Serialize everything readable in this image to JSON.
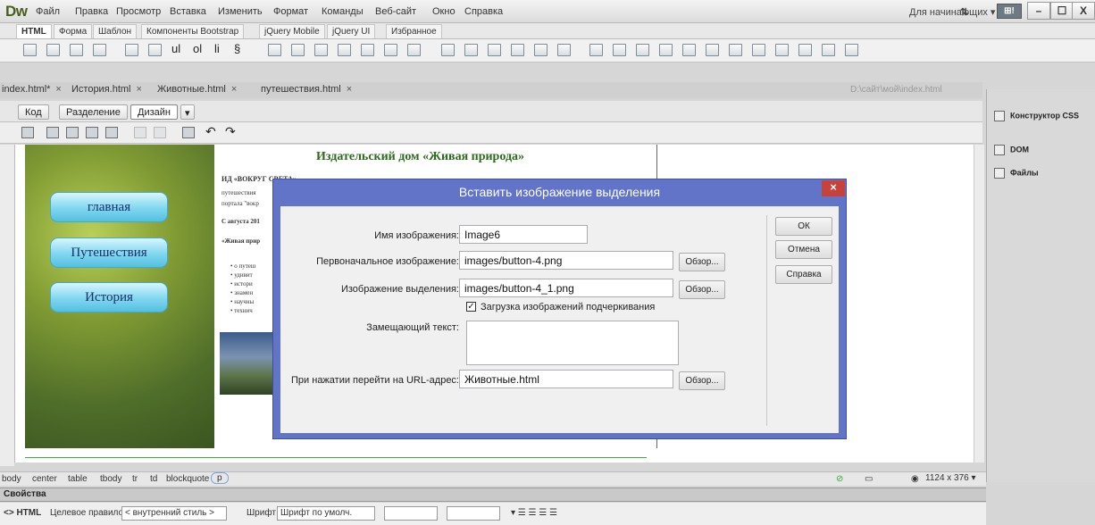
{
  "app": {
    "logo": "Dw",
    "menu": [
      "Файл",
      "Правка",
      "Просмотр",
      "Вставка",
      "Изменить",
      "Формат",
      "Команды",
      "Веб-сайт",
      "Окно",
      "Справка"
    ],
    "workspace": "Для начинающих ▾",
    "workspace_btn": "⊞!",
    "window_controls": [
      "–",
      "☐",
      "X"
    ]
  },
  "insert_tabs": [
    "HTML",
    "Форма",
    "Шаблон",
    "Компоненты Bootstrap",
    "jQuery Mobile",
    "jQuery UI",
    "Избранное"
  ],
  "document_tabs": [
    {
      "label": "index.html*"
    },
    {
      "label": "История.html"
    },
    {
      "label": "Животные.html"
    },
    {
      "label": "путешествия.html"
    }
  ],
  "document_path": "D:\\сайт\\мой\\index.html",
  "view_bar": {
    "code": "Код",
    "split": "Разделение",
    "design": "Дизайн",
    "dropdown": "▾"
  },
  "page": {
    "site_title": "Издательский дом «Живая природа»",
    "nav": [
      "главная",
      "Путешествия",
      "История"
    ],
    "text_lines": [
      "ИД «ВОКРУГ СВЕТА»",
      "путешествия",
      "портала \"вокр",
      "С августа 201",
      "«Живая прир",
      "• о путеш",
      "• удивит",
      "• истори",
      "• знамен",
      "• научны",
      "• технич"
    ]
  },
  "status_bar": {
    "tags": [
      "body",
      "center",
      "table",
      "tbody",
      "tr",
      "td",
      "blockquote",
      "p"
    ],
    "size": "1124 x 376 ▾"
  },
  "properties": {
    "title": "Свойства",
    "html_label": "<> HTML",
    "target_rule_label": "Целевое правило",
    "target_rule_value": "< внутренний стиль >",
    "font_label": "Шрифт",
    "font_value": "Шрифт по умолч."
  },
  "right_panel": {
    "items": [
      "Конструктор CSS",
      "DOM",
      "Файлы"
    ]
  },
  "dialog": {
    "title": "Вставить изображение выделения",
    "close": "×",
    "fields": {
      "image_name_label": "Имя изображения:",
      "image_name_value": "Image6",
      "original_label": "Первоначальное изображение:",
      "original_value": "images/button-4.png",
      "rollover_label": "Изображение выделения:",
      "rollover_value": "images/button-4_1.png",
      "preload_label": "Загрузка изображений подчеркивания",
      "alt_label": "Замещающий текст:",
      "url_label": "При нажатии перейти на URL-адрес:",
      "url_value": "Животные.html"
    },
    "browse": "Обзор...",
    "buttons": {
      "ok": "ОК",
      "cancel": "Отмена",
      "help": "Справка"
    }
  }
}
